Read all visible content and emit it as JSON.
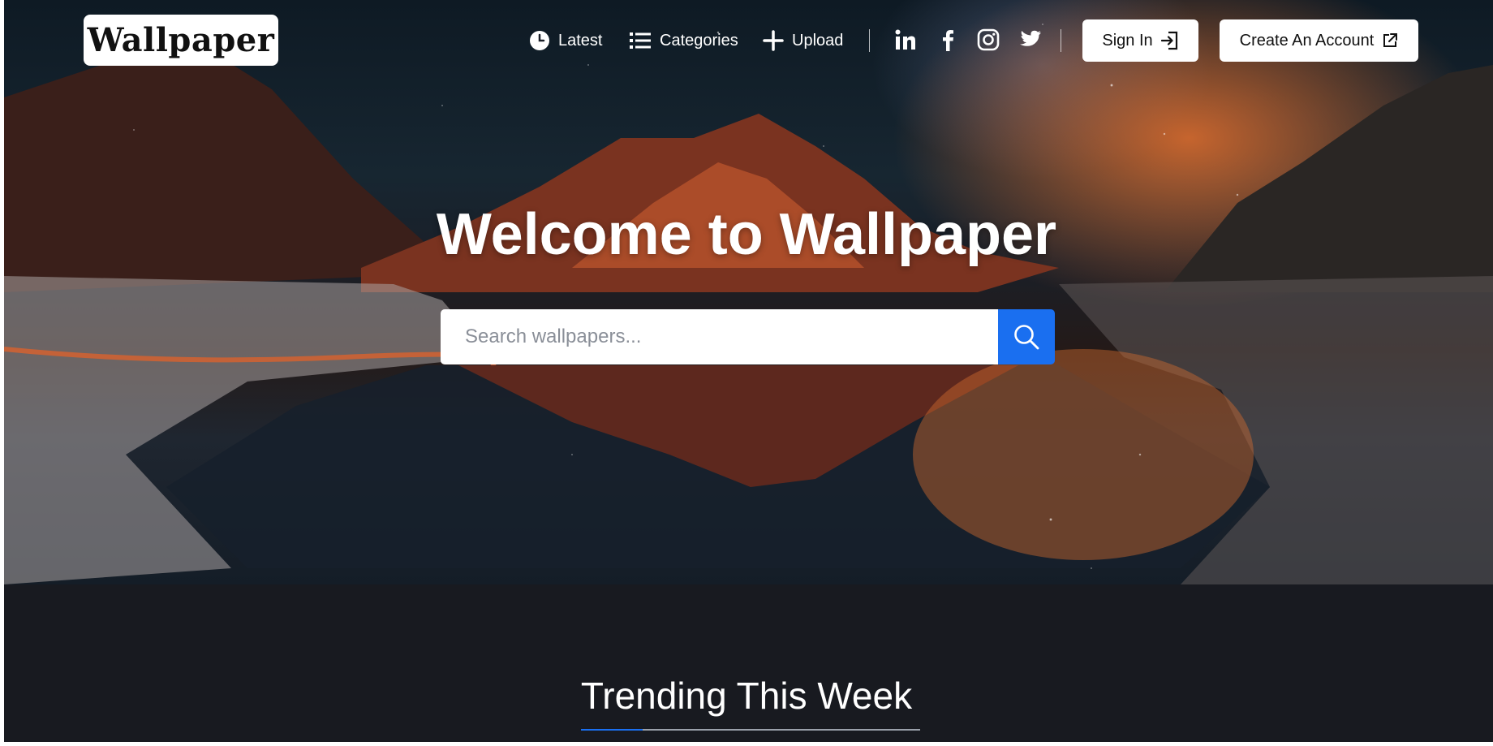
{
  "brand": {
    "logo_text": "Wallpaper"
  },
  "nav": {
    "latest": "Latest",
    "categories": "Categories",
    "upload": "Upload"
  },
  "social": [
    "linkedin-icon",
    "facebook-icon",
    "instagram-icon",
    "twitter-icon"
  ],
  "auth": {
    "sign_in": "Sign In",
    "create_account": "Create An Account"
  },
  "hero": {
    "title": "Welcome to Wallpaper",
    "search_placeholder": "Search wallpapers..."
  },
  "sections": {
    "trending_title": "Trending This Week"
  },
  "colors": {
    "accent": "#1a6ff0",
    "dark_section": "#181a20"
  }
}
